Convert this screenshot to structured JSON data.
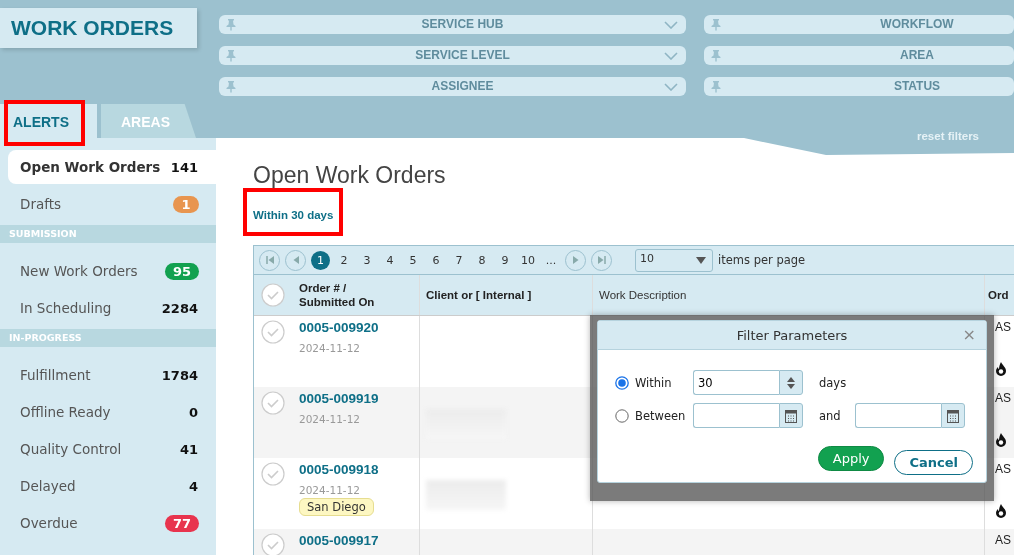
{
  "app_title": "WORK ORDERS",
  "tabs": [
    {
      "label": "ALERTS",
      "selected": true,
      "highlighted": true
    },
    {
      "label": "AREAS",
      "selected": false,
      "highlighted": false
    }
  ],
  "filters": [
    {
      "label": "SERVICE HUB",
      "has_caret": true
    },
    {
      "label": "WORKFLOW",
      "has_caret": false
    },
    {
      "label": "SERVICE LEVEL",
      "has_caret": true
    },
    {
      "label": "AREA",
      "has_caret": false
    },
    {
      "label": "ASSIGNEE",
      "has_caret": true
    },
    {
      "label": "STATUS",
      "has_caret": false
    }
  ],
  "reset_filters": "reset filters",
  "sidebar": {
    "items": [
      {
        "kind": "item",
        "label": "Open Work Orders",
        "count": "141",
        "selected": true
      },
      {
        "kind": "item",
        "label": "Drafts",
        "count": "1",
        "color": "#e8954f",
        "selected": false
      },
      {
        "kind": "section",
        "label": "SUBMISSION"
      },
      {
        "kind": "item",
        "label": "New Work Orders",
        "count": "95",
        "color": "#12a150",
        "selected": false
      },
      {
        "kind": "item",
        "label": "In Scheduling",
        "count": "2284",
        "selected": false
      },
      {
        "kind": "section",
        "label": "IN-PROGRESS"
      },
      {
        "kind": "item",
        "label": "Fulfillment",
        "count": "1784",
        "selected": false
      },
      {
        "kind": "item",
        "label": "Offline Ready",
        "count": "0",
        "selected": false
      },
      {
        "kind": "item",
        "label": "Quality Control",
        "count": "41",
        "selected": false
      },
      {
        "kind": "item",
        "label": "Delayed",
        "count": "4",
        "selected": false
      },
      {
        "kind": "item",
        "label": "Overdue",
        "count": "77",
        "color": "#e8344e",
        "selected": false
      }
    ]
  },
  "page_title": "Open Work Orders",
  "filter_link": {
    "label": "Within 30 days",
    "highlighted": true
  },
  "pager": {
    "pages": [
      {
        "label": "1",
        "selected": true
      },
      {
        "label": "2",
        "selected": false
      },
      {
        "label": "3",
        "selected": false
      },
      {
        "label": "4",
        "selected": false
      },
      {
        "label": "5",
        "selected": false
      },
      {
        "label": "6",
        "selected": false
      },
      {
        "label": "7",
        "selected": false
      },
      {
        "label": "8",
        "selected": false
      },
      {
        "label": "9",
        "selected": false
      },
      {
        "label": "10",
        "selected": false
      },
      {
        "label": "...",
        "selected": false
      }
    ],
    "page_size": "10",
    "page_size_label": "items per page"
  },
  "table": {
    "all_checked": false,
    "columns": [
      "Order # / Submitted On",
      "Client or [ Internal ]",
      "Work Description",
      "Ord"
    ],
    "rows": [
      {
        "order": "0005-009920",
        "date": "2024-11-12",
        "checked": false,
        "blurred_client": false,
        "column_4": "AS",
        "urgent": true
      },
      {
        "order": "0005-009919",
        "date": "2024-11-12",
        "checked": false,
        "blurred_client": true,
        "column_4": "AS",
        "urgent": true
      },
      {
        "order": "0005-009918",
        "date": "2024-11-12",
        "tag": "San Diego",
        "checked": false,
        "blurred_client": true,
        "column_4": "AS",
        "urgent": true
      },
      {
        "order": "0005-009917",
        "checked": false,
        "blurred_client": false,
        "column_4": "AS",
        "urgent": false
      }
    ]
  },
  "dialog": {
    "title": "Filter Parameters",
    "close": "×",
    "within": {
      "label": "Within",
      "selected": true,
      "value": "30",
      "unit": "days"
    },
    "between": {
      "label": "Between",
      "selected": false,
      "joiner": "and"
    },
    "buttons": [
      {
        "label": "Apply",
        "kind": "primary"
      },
      {
        "label": "Cancel",
        "kind": "secondary"
      }
    ]
  }
}
